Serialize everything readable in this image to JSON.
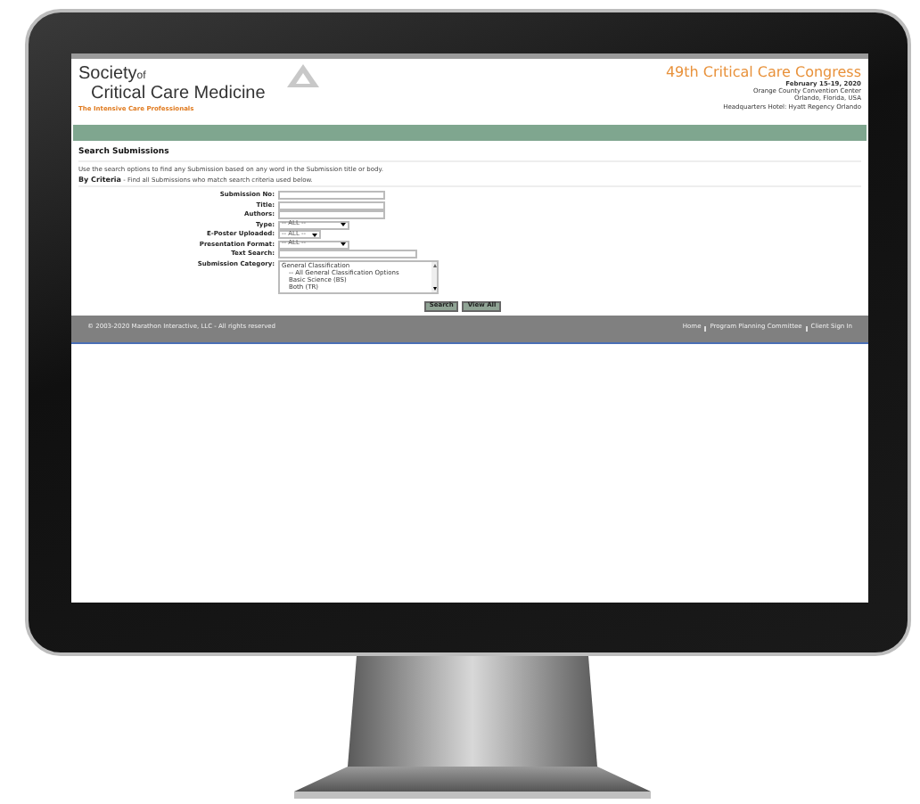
{
  "header": {
    "logo_words": [
      "Society",
      "of",
      "Critical Care Medicine"
    ],
    "tagline": "The Intensive Care Professionals",
    "event_title": "49th Critical Care Congress",
    "event_lines": [
      "February 15-19, 2020",
      "Orange County Convention Center",
      "Orlando, Florida, USA",
      "Headquarters Hotel: Hyatt Regency Orlando"
    ]
  },
  "page_title": "Search Submissions",
  "intro": "Use the search options to find any Submission based on any word in the Submission title or body.",
  "criteria": {
    "heading": "By Criteria",
    "text": " - Find all Submissions who match search criteria used below."
  },
  "fields": [
    {
      "label": "Submission No:",
      "kind": "text"
    },
    {
      "label": "Title:",
      "kind": "text"
    },
    {
      "label": "Authors:",
      "kind": "text"
    },
    {
      "label": "Type:",
      "kind": "select",
      "value": "-- ALL --"
    },
    {
      "label": "E-Poster Uploaded:",
      "kind": "select-short",
      "value": "-- ALL --"
    },
    {
      "label": "Presentation Format:",
      "kind": "select",
      "value": "-- ALL --"
    },
    {
      "label": "Text Search:",
      "kind": "text-wide"
    },
    {
      "label": "Submission Category:",
      "kind": "listbox",
      "options": [
        "General Classification",
        "-- All General Classification Options",
        "Basic Science (BS)",
        "Both (TR)"
      ]
    }
  ],
  "buttons": [
    "Search",
    "View All"
  ],
  "footer": {
    "copyright": "© 2003-2020 Marathon Interactive, LLC - All rights reserved",
    "links": [
      "Home",
      "Program Planning Committee",
      "Client Sign In"
    ]
  }
}
